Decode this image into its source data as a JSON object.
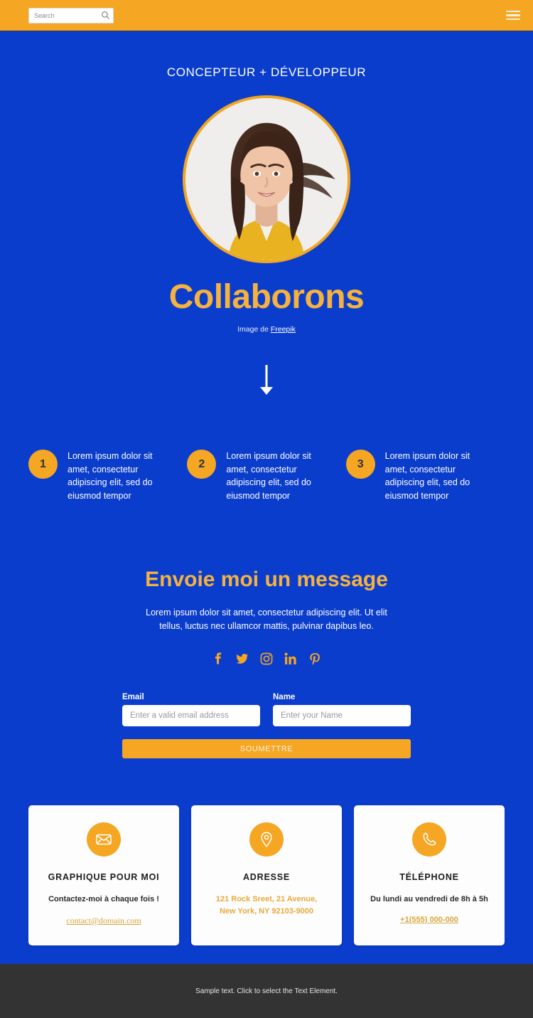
{
  "colors": {
    "brand_blue": "#0b3dcc",
    "accent_orange": "#f5a623",
    "title_gold": "#f5b23f",
    "card_bg": "#fdfdfd",
    "footer_bg": "#333333",
    "link_gold": "#d9a63a"
  },
  "topbar": {
    "search_placeholder": "Search",
    "search_value": "",
    "search_icon": "search-icon",
    "menu_icon": "hamburger-menu-icon"
  },
  "hero": {
    "eyebrow": "CONCEPTEUR + DÉVELOPPEUR",
    "title": "Collaborons",
    "avatar_alt": "portrait-photo",
    "credit_prefix": "Image de ",
    "credit_link": "Freepik",
    "scroll_icon": "arrow-down-icon"
  },
  "steps": [
    {
      "number": "1",
      "text": "Lorem ipsum dolor sit amet, consectetur adipiscing elit, sed do eiusmod tempor"
    },
    {
      "number": "2",
      "text": "Lorem ipsum dolor sit amet, consectetur adipiscing elit, sed do eiusmod tempor"
    },
    {
      "number": "3",
      "text": "Lorem ipsum dolor sit amet, consectetur adipiscing elit, sed do eiusmod tempor"
    }
  ],
  "message": {
    "title": "Envoie moi un message",
    "subtitle": "Lorem ipsum dolor sit amet, consectetur adipiscing elit. Ut elit tellus, luctus nec ullamcor mattis, pulvinar dapibus leo.",
    "socials": [
      {
        "name": "facebook-icon",
        "label": "Facebook"
      },
      {
        "name": "twitter-icon",
        "label": "Twitter"
      },
      {
        "name": "instagram-icon",
        "label": "Instagram"
      },
      {
        "name": "linkedin-icon",
        "label": "LinkedIn"
      },
      {
        "name": "pinterest-icon",
        "label": "Pinterest"
      }
    ]
  },
  "form": {
    "email_label": "Email",
    "email_placeholder": "Enter a valid email address",
    "email_value": "",
    "name_label": "Name",
    "name_placeholder": "Enter your Name",
    "name_value": "",
    "submit_label": "SOUMETTRE"
  },
  "cards": [
    {
      "icon": "envelope-icon",
      "title": "GRAPHIQUE POUR MOI",
      "subtitle": "Contactez-moi à chaque fois !",
      "link": "contact@domain.com"
    },
    {
      "icon": "map-pin-icon",
      "title": "ADRESSE",
      "subtitle": "121 Rock Sreet, 21 Avenue,\nNew York, NY 92103-9000",
      "subtitle_line1": "121 Rock Sreet, 21 Avenue,",
      "subtitle_line2": "New York, NY 92103-9000",
      "link": ""
    },
    {
      "icon": "phone-icon",
      "title": "TÉLÉPHONE",
      "subtitle": "Du lundi au vendredi de 8h à 5h",
      "link": "+1(555) 000-000"
    }
  ],
  "footer": {
    "text": "Sample text. Click to select the Text Element."
  }
}
